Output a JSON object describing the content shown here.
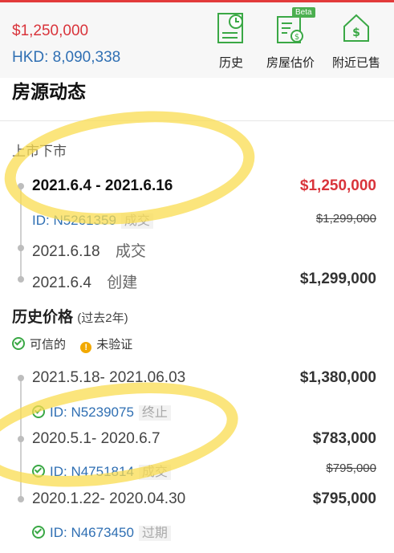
{
  "header": {
    "price_usd": "$1,250,000",
    "price_hkd": "HKD: 8,090,338",
    "buttons": [
      {
        "label": "历史",
        "icon": "history-icon"
      },
      {
        "label": "房屋估价",
        "icon": "valuation-icon",
        "badge": "Beta"
      },
      {
        "label": "附近已售",
        "icon": "nearby-sold-icon"
      }
    ]
  },
  "section_title": "房源动态",
  "listing": {
    "heading": "上市下市",
    "rows": [
      {
        "date": "2021.6.4 - 2021.6.16",
        "price": "$1,250,000",
        "id": "ID: N5261359",
        "tag": "成交",
        "old_price": "$1,299,000"
      },
      {
        "date": "2021.6.18",
        "status": "成交"
      },
      {
        "date": "2021.6.4",
        "status": "创建",
        "price": "$1,299,000"
      }
    ]
  },
  "history": {
    "title": "历史价格",
    "subtitle": "(过去2年)",
    "legend_verified": "可信的",
    "legend_unverified": "未验证",
    "rows": [
      {
        "date": "2021.5.18- 2021.06.03",
        "price": "$1,380,000",
        "id": "ID: N5239075",
        "tag": "终止"
      },
      {
        "date": "2020.5.1- 2020.6.7",
        "price": "$783,000",
        "id": "ID: N4751814",
        "tag": "成交",
        "old_price": "$795,000"
      },
      {
        "date": "2020.1.22- 2020.04.30",
        "price": "$795,000",
        "id": "ID: N4673450",
        "tag": "过期"
      }
    ]
  },
  "colors": {
    "accent_red": "#d9343b",
    "link_blue": "#2f6fb3",
    "verified_green": "#3aa845",
    "highlight": "#fadc50"
  }
}
